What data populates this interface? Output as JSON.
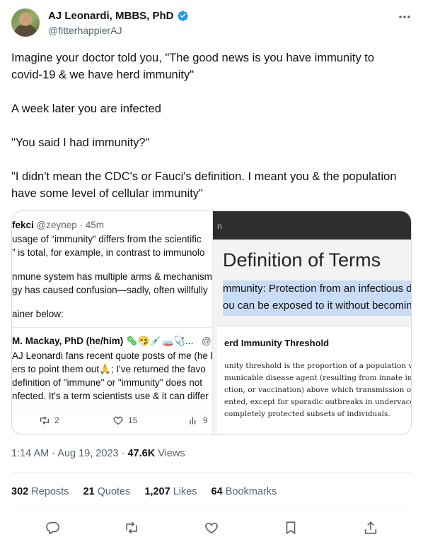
{
  "author": {
    "name": "AJ Leonardi, MBBS, PhD",
    "handle": "@fitterhappierAJ",
    "verified_color": "#1d9bf0"
  },
  "tweet": {
    "paragraphs": [
      "Imagine your doctor told you, \"The good news is you have immunity to\ncovid-19 & we have herd immunity\"",
      "A week later you are infected",
      "\"You said I had immunity?\"",
      "\"I didn't mean the CDC's or Fauci's definition. I meant you & the population\nhave some level of cellular immunity\""
    ]
  },
  "media_left": {
    "author_fragment": "fekci",
    "handle_time": "@zeynep · 45m",
    "lines": [
      "usage of “immunity” differs from the scientific",
      "” is total, for example, in contrast to immunolo",
      "nmune system has multiple arms & mechanism",
      "gy has caused confusion—sadly, often willfully",
      "ainer below:"
    ],
    "reply_author": "M. Mackay, PhD (he/him)",
    "reply_emojis": "🦠🤧💉🧫🩺...",
    "reply_at": "@",
    "reply_lines": [
      "AJ Leonardi fans recent quote posts of me (he b",
      "ers to point them out🙏; I've returned the favo",
      "definition of \"immune\" or \"immunity\" does not",
      "nfected. It's a term scientists use & it can differ"
    ],
    "retweets": "2",
    "likes": "15",
    "views": "9"
  },
  "media_right": {
    "topbar_fragment": "n",
    "title": "Definition of Terms",
    "highlight_lines": [
      "mmunity: Protection from an infectious dis",
      "ou can be exposed to it without becoming"
    ],
    "card_title": "erd Immunity Threshold",
    "card_lines": [
      "unity threshold is the proportion of a population with im",
      "municable disease agent (resulting from innate immun",
      "ction, or vaccination) above which transmission of the a",
      "ented, except for sporadic outbreaks in undervaccinated",
      "completely protected subsets of individuals."
    ]
  },
  "meta": {
    "time": "1:14 AM",
    "date": "Aug 19, 2023",
    "views_count": "47.6K",
    "views_label": "Views"
  },
  "stats": {
    "reposts_count": "302",
    "reposts_label": "Reposts",
    "quotes_count": "21",
    "quotes_label": "Quotes",
    "likes_count": "1,207",
    "likes_label": "Likes",
    "bookmarks_count": "64",
    "bookmarks_label": "Bookmarks"
  },
  "icons": [
    "reply-icon",
    "repost-icon",
    "like-icon",
    "bookmark-icon",
    "share-icon",
    "more-icon",
    "verified-icon"
  ]
}
